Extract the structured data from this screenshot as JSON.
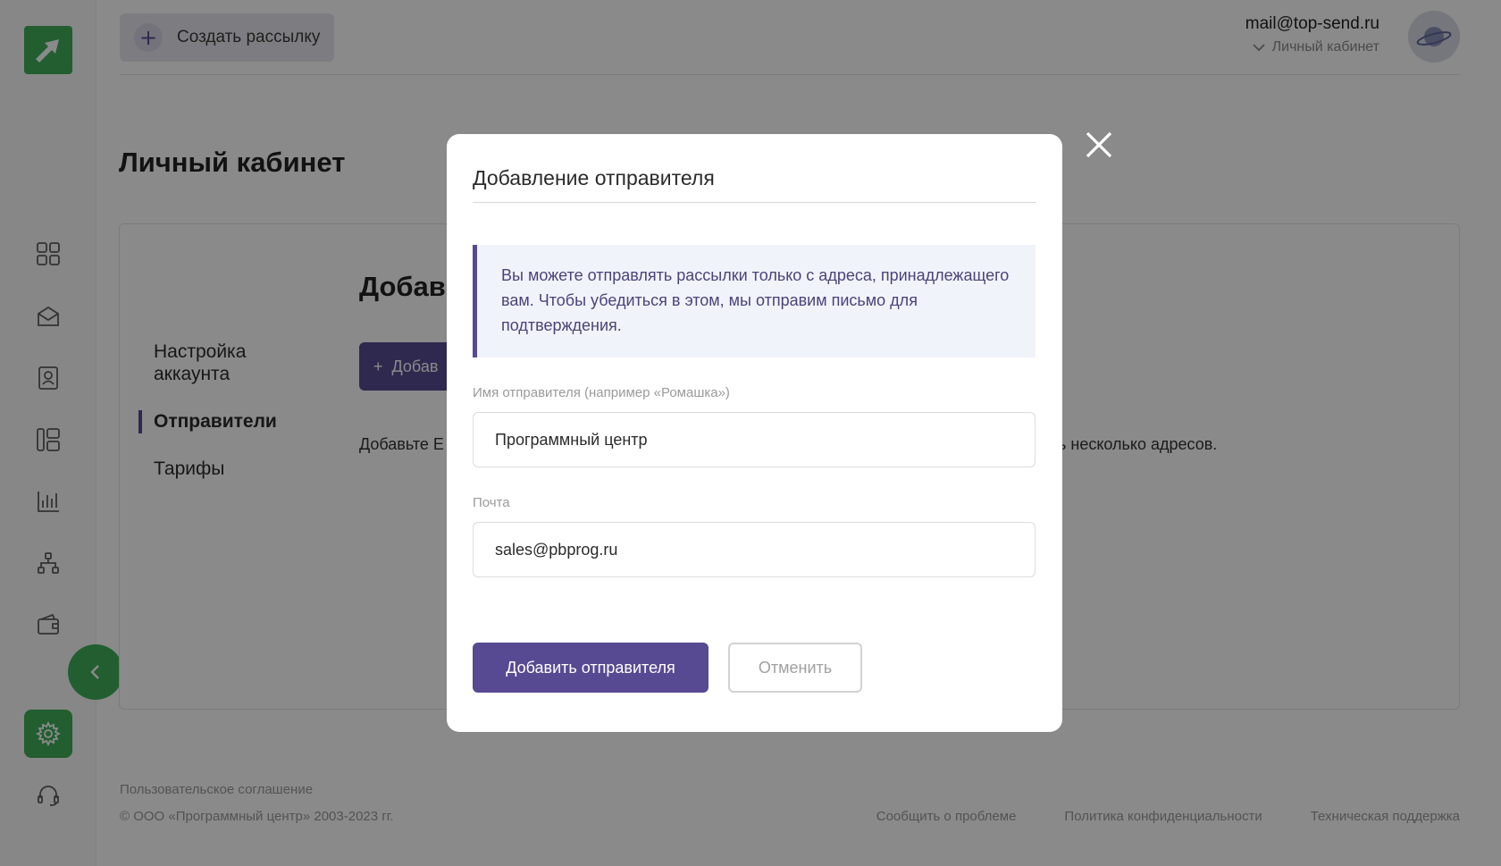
{
  "header": {
    "create_label": "Создать рассылку",
    "email": "mail@top-send.ru",
    "cabinet_label": "Личный кабинет"
  },
  "sidebar": {
    "icons": [
      "dashboard-icon",
      "mail-icon",
      "contacts-icon",
      "templates-icon",
      "stats-icon",
      "structure-icon",
      "wallet-icon",
      "settings-icon",
      "support-icon"
    ]
  },
  "page": {
    "title": "Личный кабинет",
    "menu": [
      {
        "label": "Настройка аккаунта"
      },
      {
        "label": "Отправители"
      },
      {
        "label": "Тарифы"
      }
    ],
    "section_title": "Добав",
    "add_button_label": "Добав",
    "hint_left": "Добавьте E",
    "hint_right": "ь несколько адресов."
  },
  "footer": {
    "terms": "Пользовательское соглашение",
    "copyright": "© ООО «Программный центр» 2003-2023 гг.",
    "links": [
      "Сообщить о проблеме",
      "Политика конфиденциальности",
      "Техническая поддержка"
    ]
  },
  "modal": {
    "title": "Добавление отправителя",
    "info": "Вы можете отправлять рассылки только с адреса, принадлежащего вам. Чтобы убедиться в этом, мы отправим письмо для подтверждения.",
    "name_label": "Имя отправителя (например «Ромашка»)",
    "name_value": "Программный центр",
    "email_label": "Почта",
    "email_value": "sales@pbprog.ru",
    "submit_label": "Добавить отправителя",
    "cancel_label": "Отменить"
  },
  "colors": {
    "brand_green": "#3fae5a",
    "accent_purple": "#574a92",
    "info_bg": "#f1f3fb"
  }
}
